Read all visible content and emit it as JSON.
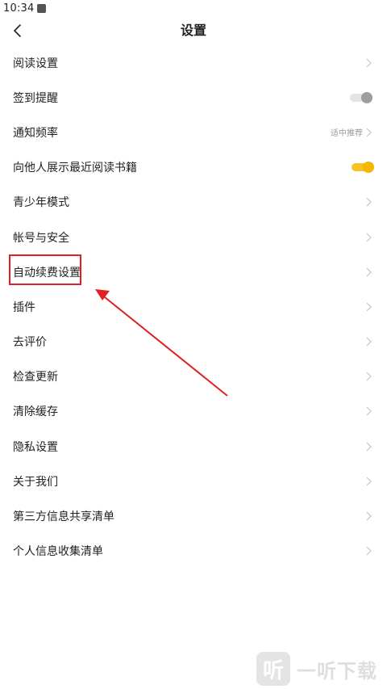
{
  "status_bar": {
    "time": "10:34"
  },
  "header": {
    "title": "设置"
  },
  "settings": [
    {
      "label": "阅读设置",
      "control": "chevron"
    },
    {
      "label": "签到提醒",
      "control": "toggle",
      "on": false
    },
    {
      "label": "通知频率",
      "control": "chevron",
      "value": "适中推荐"
    },
    {
      "label": "向他人展示最近阅读书籍",
      "control": "toggle",
      "on": true
    },
    {
      "label": "青少年模式",
      "control": "chevron"
    },
    {
      "label": "帐号与安全",
      "control": "chevron"
    },
    {
      "label": "自动续费设置",
      "control": "chevron"
    },
    {
      "label": "插件",
      "control": "chevron"
    },
    {
      "label": "去评价",
      "control": "chevron"
    },
    {
      "label": "检查更新",
      "control": "chevron"
    },
    {
      "label": "清除缓存",
      "control": "chevron"
    },
    {
      "label": "隐私设置",
      "control": "chevron"
    },
    {
      "label": "关于我们",
      "control": "chevron"
    },
    {
      "label": "第三方信息共享清单",
      "control": "chevron"
    },
    {
      "label": "个人信息收集清单",
      "control": "chevron"
    }
  ],
  "colors": {
    "toggle_on": "#f7c324",
    "toggle_off": "#e4e4e4",
    "annotation": "#e41f1f"
  },
  "watermark": {
    "logo_glyph": "听",
    "text": "一听下载"
  }
}
